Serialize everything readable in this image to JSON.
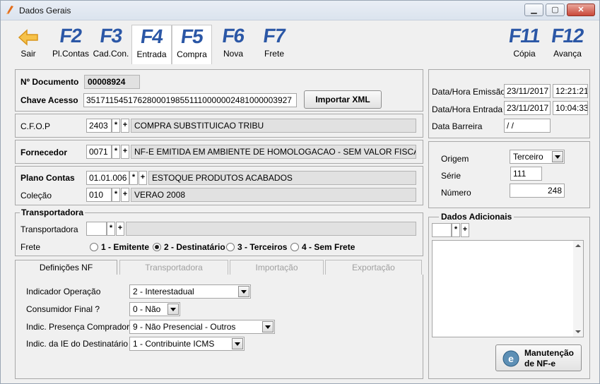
{
  "window": {
    "title": "Dados Gerais"
  },
  "toolbar": {
    "sair": "Sair",
    "f2": {
      "key": "F2",
      "label": "Pl.Contas"
    },
    "f3": {
      "key": "F3",
      "label": "Cad.Con."
    },
    "f4": {
      "key": "F4",
      "label": "Entrada"
    },
    "f5": {
      "key": "F5",
      "label": "Compra"
    },
    "f6": {
      "key": "F6",
      "label": "Nova"
    },
    "f7": {
      "key": "F7",
      "label": "Frete"
    },
    "f11": {
      "key": "F11",
      "label": "Cópia"
    },
    "f12": {
      "key": "F12",
      "label": "Avança"
    }
  },
  "documento": {
    "label": "Nº Documento",
    "value": "00008924"
  },
  "chave": {
    "label": "Chave Acesso",
    "value": "35171154517628000198551110000002481000003927",
    "import_button": "Importar XML"
  },
  "cfop": {
    "label": "C.F.O.P",
    "code": "2403",
    "desc": "COMPRA SUBSTITUICAO TRIBU"
  },
  "fornecedor": {
    "label": "Fornecedor",
    "code": "0071",
    "desc": "NF-E EMITIDA EM AMBIENTE DE HOMOLOGACAO - SEM VALOR FISCAL"
  },
  "plano": {
    "label": "Plano Contas",
    "code": "01.01.006",
    "desc": "ESTOQUE PRODUTOS ACABADOS"
  },
  "colecao": {
    "label": "Coleção",
    "code": "010",
    "desc": "VERAO 2008"
  },
  "transportadora": {
    "group": "Transportadora",
    "label": "Transportadora",
    "code": "",
    "desc": ""
  },
  "frete": {
    "label": "Frete",
    "options": [
      "1 - Emitente",
      "2 - Destinatário",
      "3 - Terceiros",
      "4 - Sem Frete"
    ],
    "selected": 1
  },
  "btn_symbols": {
    "star": "*",
    "plus": "+"
  },
  "datas": {
    "emissao_label": "Data/Hora Emissão",
    "emissao_date": "23/11/2017",
    "emissao_time": "12:21:21",
    "entrada_label": "Data/Hora Entrada",
    "entrada_date": "23/11/2017",
    "entrada_time": "10:04:33",
    "barreira_label": "Data Barreira",
    "barreira_value": " / /"
  },
  "origem": {
    "label": "Origem",
    "value": "Terceiro"
  },
  "serie": {
    "label": "Série",
    "value": "111"
  },
  "numero": {
    "label": "Número",
    "value": "248"
  },
  "adicionais": {
    "group": "Dados Adicionais",
    "code": ""
  },
  "tabs": [
    "Definições NF",
    "Transportadora",
    "Importação",
    "Exportação"
  ],
  "defs": {
    "indicador_label": "Indicador Operação",
    "indicador_value": "2 - Interestadual",
    "consumidor_label": "Consumidor Final ?",
    "consumidor_value": "0 - Não",
    "presenca_label": "Indic. Presença Comprador",
    "presenca_value": "9 - Não Presencial - Outros",
    "ie_label": "Indic. da IE do Destinatário",
    "ie_value": "1 - Contribuinte ICMS"
  },
  "manutencao": {
    "line1": "Manutenção",
    "line2": "de NF-e"
  }
}
